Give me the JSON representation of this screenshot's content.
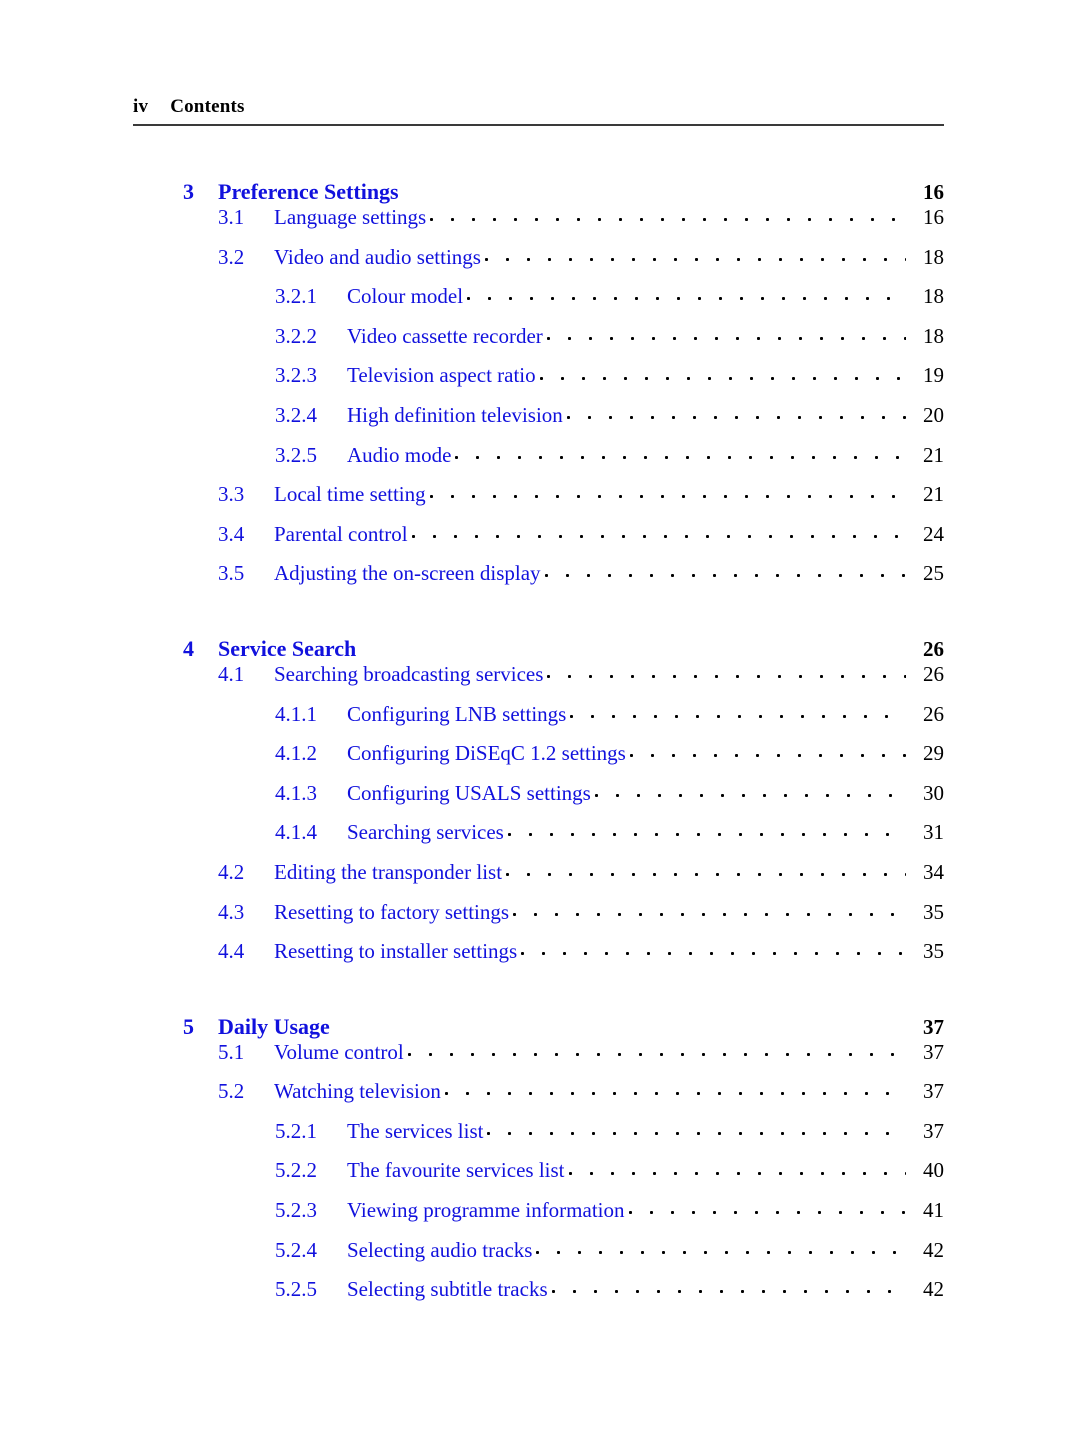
{
  "header": {
    "folio": "iv",
    "title": "Contents",
    "rule_color": "#3a3a3a"
  },
  "colors": {
    "link_blue": "#1111dd",
    "text_black": "#000000",
    "leader_black": "#000000"
  },
  "toc": {
    "entries": [
      {
        "level": 1,
        "number": "3",
        "title": "Preference Settings",
        "page": "16"
      },
      {
        "level": 2,
        "number": "3.1",
        "title": "Language settings",
        "page": "16"
      },
      {
        "level": 2,
        "number": "3.2",
        "title": "Video and audio settings",
        "page": "18"
      },
      {
        "level": 3,
        "number": "3.2.1",
        "title": "Colour model",
        "page": "18"
      },
      {
        "level": 3,
        "number": "3.2.2",
        "title": "Video cassette recorder",
        "page": "18"
      },
      {
        "level": 3,
        "number": "3.2.3",
        "title": "Television aspect ratio",
        "page": "19"
      },
      {
        "level": 3,
        "number": "3.2.4",
        "title": "High definition television",
        "page": "20"
      },
      {
        "level": 3,
        "number": "3.2.5",
        "title": "Audio mode",
        "page": "21"
      },
      {
        "level": 2,
        "number": "3.3",
        "title": "Local time setting",
        "page": "21"
      },
      {
        "level": 2,
        "number": "3.4",
        "title": "Parental control",
        "page": "24"
      },
      {
        "level": 2,
        "number": "3.5",
        "title": "Adjusting the on-screen display",
        "page": "25"
      },
      {
        "level": 1,
        "number": "4",
        "title": "Service Search",
        "page": "26"
      },
      {
        "level": 2,
        "number": "4.1",
        "title": "Searching broadcasting services",
        "page": "26"
      },
      {
        "level": 3,
        "number": "4.1.1",
        "title": "Configuring LNB settings",
        "page": "26"
      },
      {
        "level": 3,
        "number": "4.1.2",
        "title": "Configuring DiSEqC 1.2 settings",
        "page": "29"
      },
      {
        "level": 3,
        "number": "4.1.3",
        "title": "Configuring USALS settings",
        "page": "30"
      },
      {
        "level": 3,
        "number": "4.1.4",
        "title": "Searching services",
        "page": "31"
      },
      {
        "level": 2,
        "number": "4.2",
        "title": "Editing the transponder list",
        "page": "34"
      },
      {
        "level": 2,
        "number": "4.3",
        "title": "Resetting to factory settings",
        "page": "35"
      },
      {
        "level": 2,
        "number": "4.4",
        "title": "Resetting to installer settings",
        "page": "35"
      },
      {
        "level": 1,
        "number": "5",
        "title": "Daily Usage",
        "page": "37"
      },
      {
        "level": 2,
        "number": "5.1",
        "title": "Volume control",
        "page": "37"
      },
      {
        "level": 2,
        "number": "5.2",
        "title": "Watching television",
        "page": "37"
      },
      {
        "level": 3,
        "number": "5.2.1",
        "title": "The services list",
        "page": "37"
      },
      {
        "level": 3,
        "number": "5.2.2",
        "title": "The favourite services list",
        "page": "40"
      },
      {
        "level": 3,
        "number": "5.2.3",
        "title": "Viewing programme information",
        "page": "41"
      },
      {
        "level": 3,
        "number": "5.2.4",
        "title": "Selecting audio tracks",
        "page": "42"
      },
      {
        "level": 3,
        "number": "5.2.5",
        "title": "Selecting subtitle tracks",
        "page": "42"
      }
    ]
  }
}
